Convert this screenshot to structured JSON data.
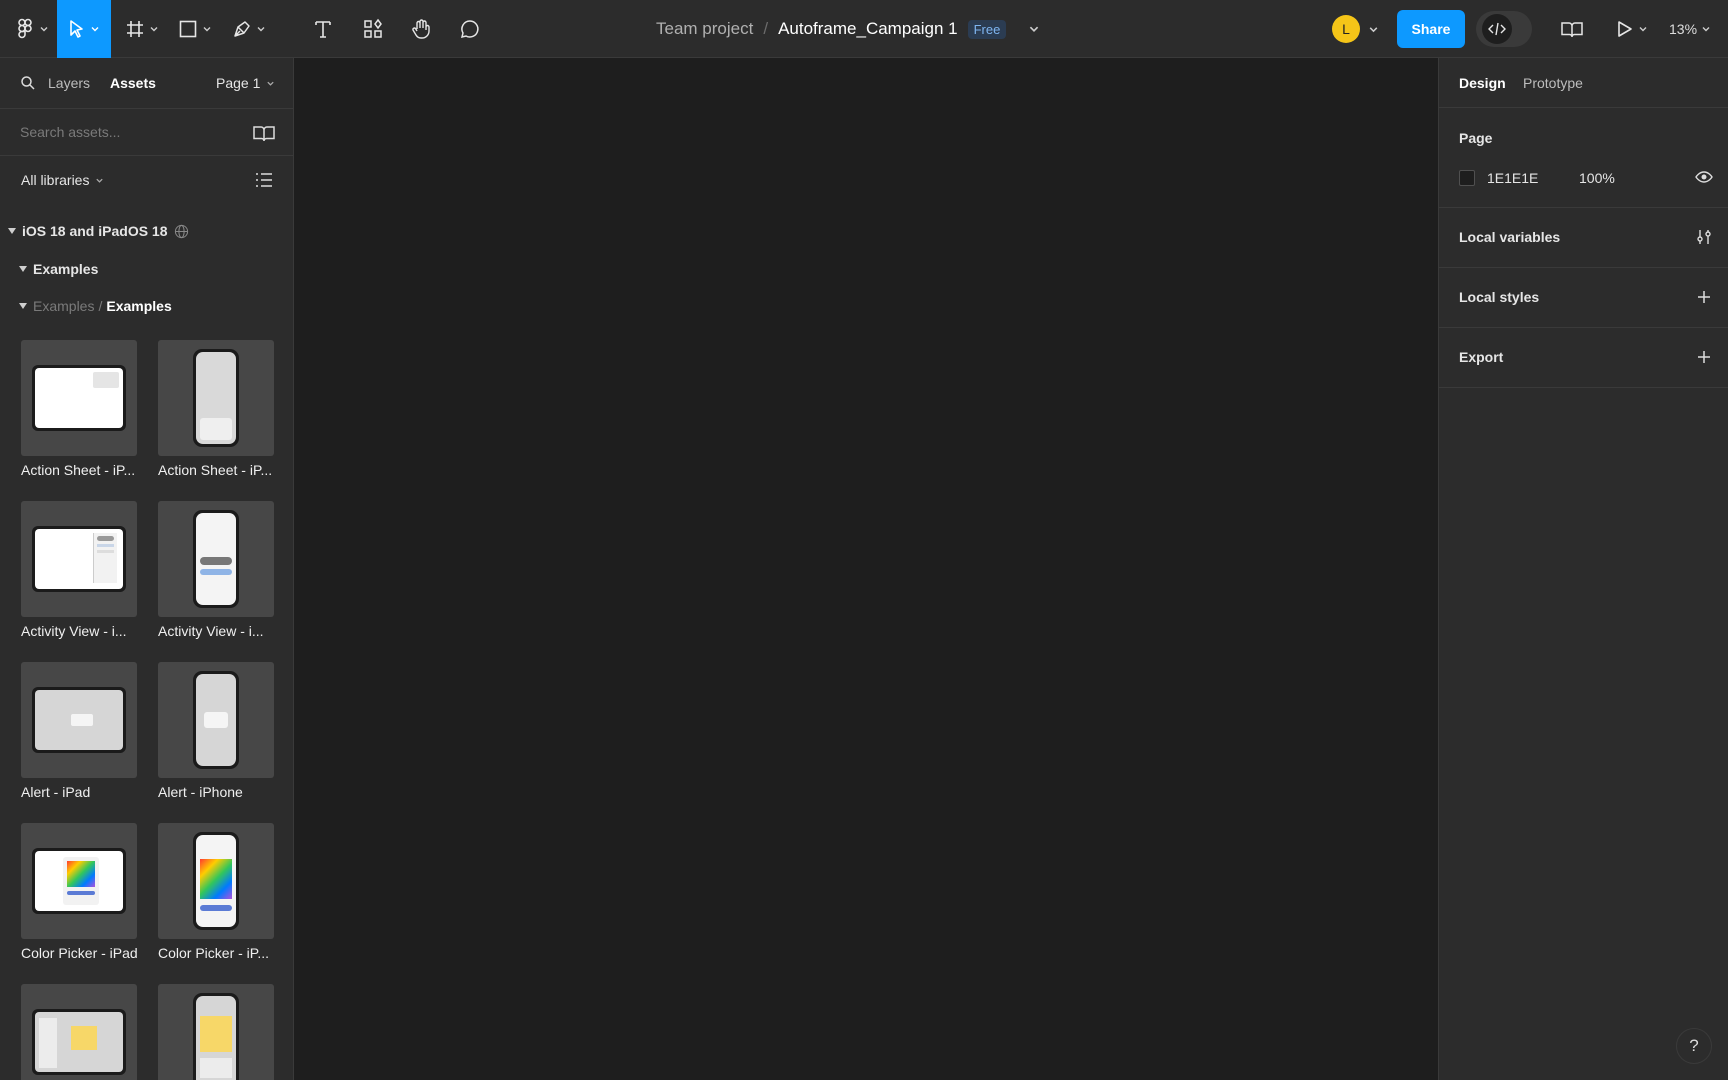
{
  "toolbar": {
    "file": {
      "team": "Team project",
      "separator": "/",
      "name": "Autoframe_Campaign 1",
      "plan_badge": "Free"
    },
    "avatar_initial": "L",
    "share_label": "Share",
    "zoom": "13%",
    "icons": [
      "figma-menu-icon",
      "move-tool-icon",
      "frame-tool-icon",
      "shape-tool-icon",
      "pen-tool-icon",
      "text-tool-icon",
      "resources-icon",
      "hand-tool-icon",
      "comment-icon",
      "dev-mode-icon",
      "library-icon",
      "present-icon"
    ],
    "accent_color": "#0d99ff"
  },
  "left_panel": {
    "tabs": {
      "layers": "Layers",
      "assets": "Assets",
      "active": "Assets"
    },
    "page_selector": "Page 1",
    "search": {
      "placeholder": "Search assets..."
    },
    "libraries_filter": "All libraries",
    "library": {
      "title": "iOS 18 and iPadOS 18",
      "group": "Examples",
      "breadcrumb": {
        "parent": "Examples",
        "separator": "/",
        "current": "Examples"
      }
    },
    "assets": [
      {
        "label": "Action Sheet - iP...",
        "device": "ipad"
      },
      {
        "label": "Action Sheet - iP...",
        "device": "iphone"
      },
      {
        "label": "Activity View - i...",
        "device": "ipad"
      },
      {
        "label": "Activity View - i...",
        "device": "iphone"
      },
      {
        "label": "Alert - iPad",
        "device": "ipad"
      },
      {
        "label": "Alert - iPhone",
        "device": "iphone"
      },
      {
        "label": "Color Picker - iPad",
        "device": "ipad"
      },
      {
        "label": "Color Picker - iP...",
        "device": "iphone"
      },
      {
        "label": "",
        "device": "ipad"
      },
      {
        "label": "",
        "device": "iphone"
      }
    ]
  },
  "right_panel": {
    "tabs": {
      "design": "Design",
      "prototype": "Prototype",
      "active": "Design"
    },
    "page": {
      "heading": "Page",
      "color_hex": "1E1E1E",
      "opacity": "100%",
      "swatch_color": "#1e1e1e"
    },
    "sections": {
      "local_variables": "Local variables",
      "local_styles": "Local styles",
      "export": "Export"
    }
  },
  "help_label": "?"
}
